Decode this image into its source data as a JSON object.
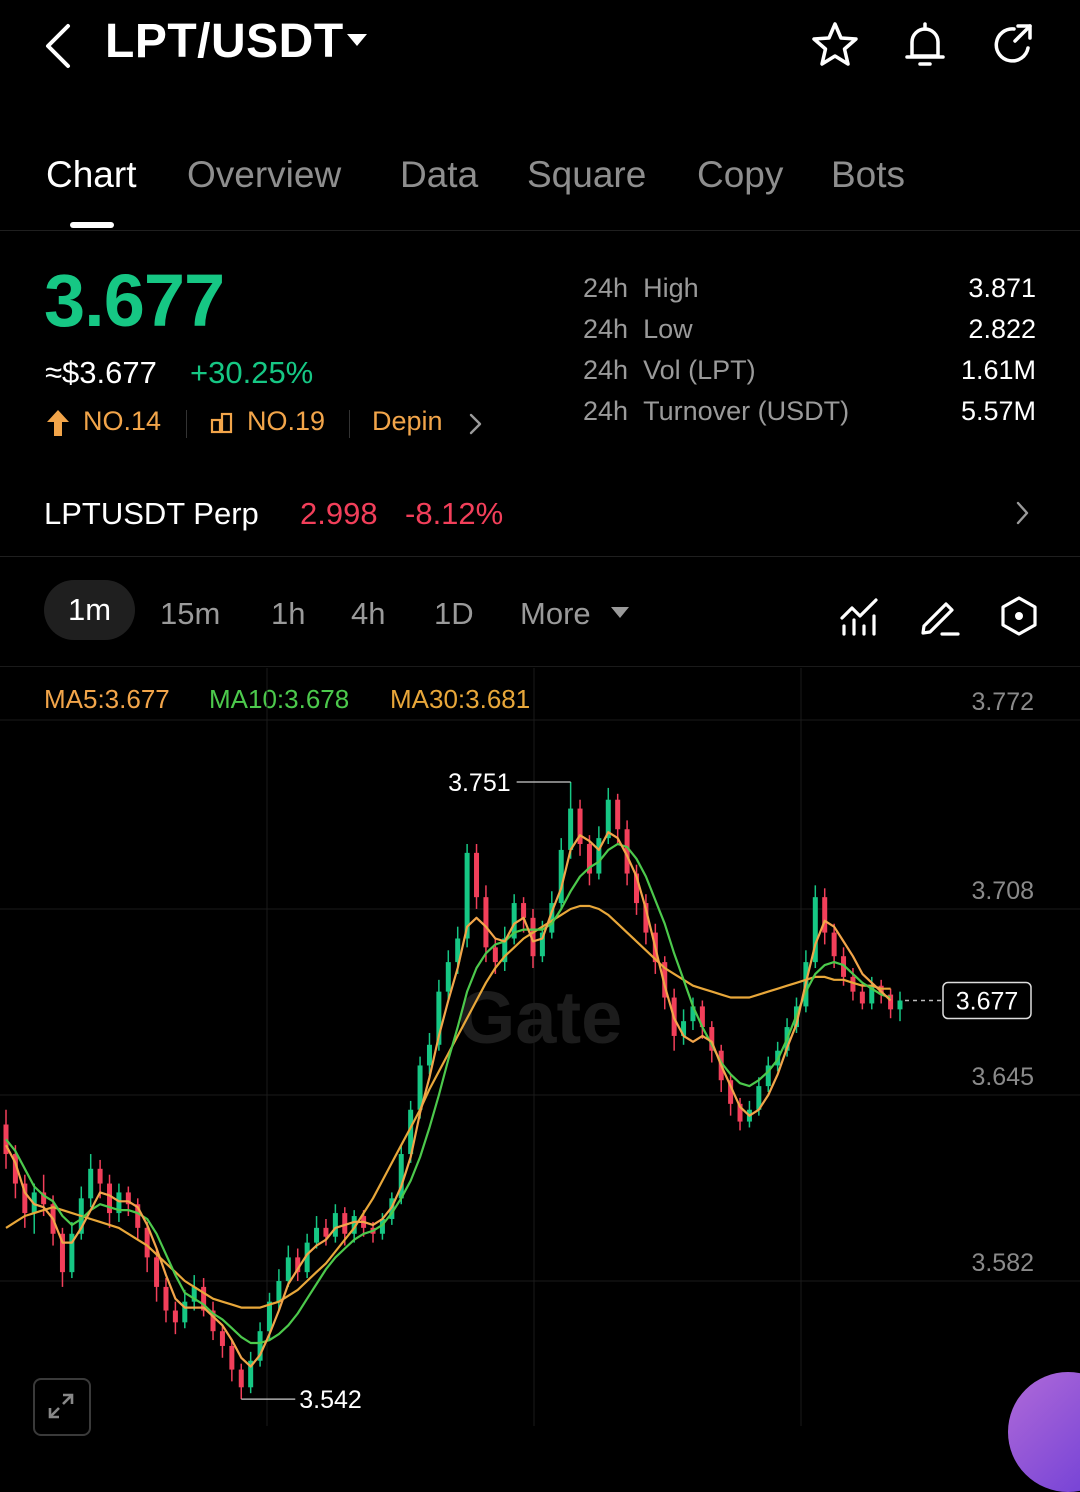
{
  "header": {
    "pair": "LPT/USDT",
    "icons": [
      "back-arrow-icon",
      "dropdown-caret-icon",
      "star-icon",
      "bell-icon",
      "share-icon"
    ]
  },
  "tabs": [
    "Chart",
    "Overview",
    "Data",
    "Square",
    "Copy",
    "Bots"
  ],
  "active_tab": "Chart",
  "ticker": {
    "price": "3.677",
    "usd_price": "≈$3.677",
    "change": "+30.25%",
    "rank1": "NO.14",
    "rank2": "NO.19",
    "tag": "Depin",
    "stats": [
      {
        "period": "24h",
        "label": "High",
        "value": "3.871"
      },
      {
        "period": "24h",
        "label": "Low",
        "value": "2.822"
      },
      {
        "period": "24h",
        "label": "Vol (LPT)",
        "value": "1.61M"
      },
      {
        "period": "24h",
        "label": "Turnover (USDT)",
        "value": "5.57M"
      }
    ]
  },
  "perp": {
    "name": "LPTUSDT Perp",
    "price": "2.998",
    "change": "-8.12%"
  },
  "timeframes": [
    "1m",
    "15m",
    "1h",
    "4h",
    "1D",
    "More"
  ],
  "active_timeframe": "1m",
  "indicators": {
    "ma5": "MA5:3.677",
    "ma10": "MA10:3.678",
    "ma30": "MA30:3.681"
  },
  "colors": {
    "up": "#16c784",
    "down": "#f23f5a",
    "ma5": "#f2a54a",
    "ma10": "#4cc94c",
    "ma30": "#e8a73a"
  },
  "chart_data": {
    "type": "candlestick",
    "y_ticks": [
      "3.772",
      "3.708",
      "3.645",
      "3.582"
    ],
    "ylim": [
      3.535,
      3.79
    ],
    "high_marker": "3.751",
    "low_marker": "3.542",
    "current_price": "3.677",
    "watermark": "Gate",
    "candles": [
      [
        3.635,
        3.625,
        3.64,
        3.62
      ],
      [
        3.625,
        3.615,
        3.628,
        3.61
      ],
      [
        3.615,
        3.605,
        3.618,
        3.6
      ],
      [
        3.605,
        3.612,
        3.615,
        3.598
      ],
      [
        3.612,
        3.608,
        3.618,
        3.604
      ],
      [
        3.608,
        3.598,
        3.611,
        3.594
      ],
      [
        3.598,
        3.585,
        3.6,
        3.58
      ],
      [
        3.585,
        3.598,
        3.602,
        3.583
      ],
      [
        3.598,
        3.61,
        3.614,
        3.596
      ],
      [
        3.61,
        3.62,
        3.625,
        3.607
      ],
      [
        3.62,
        3.615,
        3.623,
        3.61
      ],
      [
        3.615,
        3.605,
        3.618,
        3.6
      ],
      [
        3.605,
        3.612,
        3.615,
        3.602
      ],
      [
        3.612,
        3.608,
        3.614,
        3.604
      ],
      [
        3.608,
        3.6,
        3.61,
        3.596
      ],
      [
        3.6,
        3.59,
        3.602,
        3.585
      ],
      [
        3.59,
        3.58,
        3.593,
        3.575
      ],
      [
        3.58,
        3.572,
        3.583,
        3.568
      ],
      [
        3.572,
        3.568,
        3.575,
        3.564
      ],
      [
        3.568,
        3.575,
        3.579,
        3.566
      ],
      [
        3.575,
        3.58,
        3.584,
        3.572
      ],
      [
        3.58,
        3.572,
        3.583,
        3.57
      ],
      [
        3.572,
        3.565,
        3.575,
        3.562
      ],
      [
        3.565,
        3.56,
        3.567,
        3.556
      ],
      [
        3.56,
        3.552,
        3.562,
        3.548
      ],
      [
        3.552,
        3.546,
        3.554,
        3.542
      ],
      [
        3.546,
        3.555,
        3.558,
        3.544
      ],
      [
        3.555,
        3.565,
        3.568,
        3.553
      ],
      [
        3.565,
        3.575,
        3.578,
        3.562
      ],
      [
        3.575,
        3.582,
        3.586,
        3.572
      ],
      [
        3.582,
        3.59,
        3.594,
        3.58
      ],
      [
        3.59,
        3.585,
        3.593,
        3.582
      ],
      [
        3.585,
        3.595,
        3.598,
        3.583
      ],
      [
        3.595,
        3.6,
        3.604,
        3.593
      ],
      [
        3.6,
        3.597,
        3.603,
        3.594
      ],
      [
        3.597,
        3.605,
        3.608,
        3.595
      ],
      [
        3.605,
        3.598,
        3.607,
        3.594
      ],
      [
        3.598,
        3.604,
        3.606,
        3.595
      ],
      [
        3.604,
        3.6,
        3.606,
        3.597
      ],
      [
        3.6,
        3.598,
        3.602,
        3.595
      ],
      [
        3.598,
        3.603,
        3.605,
        3.596
      ],
      [
        3.603,
        3.61,
        3.612,
        3.601
      ],
      [
        3.61,
        3.625,
        3.628,
        3.608
      ],
      [
        3.625,
        3.64,
        3.643,
        3.622
      ],
      [
        3.64,
        3.655,
        3.658,
        3.637
      ],
      [
        3.655,
        3.662,
        3.666,
        3.652
      ],
      [
        3.662,
        3.68,
        3.684,
        3.66
      ],
      [
        3.68,
        3.69,
        3.694,
        3.677
      ],
      [
        3.69,
        3.698,
        3.702,
        3.686
      ],
      [
        3.698,
        3.727,
        3.73,
        3.695
      ],
      [
        3.727,
        3.712,
        3.73,
        3.708
      ],
      [
        3.712,
        3.695,
        3.716,
        3.69
      ],
      [
        3.695,
        3.69,
        3.698,
        3.686
      ],
      [
        3.69,
        3.698,
        3.702,
        3.687
      ],
      [
        3.698,
        3.71,
        3.713,
        3.696
      ],
      [
        3.71,
        3.705,
        3.712,
        3.7
      ],
      [
        3.705,
        3.692,
        3.708,
        3.688
      ],
      [
        3.692,
        3.7,
        3.704,
        3.69
      ],
      [
        3.7,
        3.71,
        3.714,
        3.698
      ],
      [
        3.71,
        3.728,
        3.732,
        3.708
      ],
      [
        3.728,
        3.742,
        3.751,
        3.725
      ],
      [
        3.742,
        3.73,
        3.745,
        3.726
      ],
      [
        3.73,
        3.72,
        3.733,
        3.716
      ],
      [
        3.72,
        3.732,
        3.736,
        3.718
      ],
      [
        3.732,
        3.745,
        3.749,
        3.73
      ],
      [
        3.745,
        3.735,
        3.747,
        3.73
      ],
      [
        3.735,
        3.72,
        3.738,
        3.716
      ],
      [
        3.72,
        3.71,
        3.723,
        3.706
      ],
      [
        3.71,
        3.7,
        3.713,
        3.696
      ],
      [
        3.7,
        3.69,
        3.703,
        3.686
      ],
      [
        3.69,
        3.678,
        3.692,
        3.674
      ],
      [
        3.678,
        3.665,
        3.681,
        3.66
      ],
      [
        3.665,
        3.67,
        3.674,
        3.662
      ],
      [
        3.67,
        3.675,
        3.678,
        3.667
      ],
      [
        3.675,
        3.668,
        3.677,
        3.664
      ],
      [
        3.668,
        3.66,
        3.67,
        3.656
      ],
      [
        3.66,
        3.65,
        3.662,
        3.646
      ],
      [
        3.65,
        3.642,
        3.652,
        3.638
      ],
      [
        3.642,
        3.636,
        3.644,
        3.633
      ],
      [
        3.636,
        3.64,
        3.643,
        3.634
      ],
      [
        3.64,
        3.648,
        3.651,
        3.638
      ],
      [
        3.648,
        3.655,
        3.658,
        3.646
      ],
      [
        3.655,
        3.66,
        3.663,
        3.653
      ],
      [
        3.66,
        3.668,
        3.671,
        3.658
      ],
      [
        3.668,
        3.675,
        3.678,
        3.666
      ],
      [
        3.675,
        3.69,
        3.694,
        3.673
      ],
      [
        3.69,
        3.712,
        3.716,
        3.688
      ],
      [
        3.712,
        3.7,
        3.715,
        3.696
      ],
      [
        3.7,
        3.692,
        3.703,
        3.688
      ],
      [
        3.692,
        3.685,
        3.695,
        3.682
      ],
      [
        3.685,
        3.68,
        3.688,
        3.677
      ],
      [
        3.68,
        3.676,
        3.683,
        3.674
      ],
      [
        3.676,
        3.682,
        3.685,
        3.674
      ],
      [
        3.682,
        3.679,
        3.684,
        3.676
      ],
      [
        3.679,
        3.674,
        3.681,
        3.671
      ],
      [
        3.674,
        3.677,
        3.68,
        3.67
      ]
    ],
    "ma5": [
      3.628,
      3.622,
      3.612,
      3.608,
      3.607,
      3.603,
      3.595,
      3.595,
      3.6,
      3.606,
      3.612,
      3.611,
      3.609,
      3.609,
      3.607,
      3.601,
      3.593,
      3.584,
      3.576,
      3.573,
      3.573,
      3.573,
      3.57,
      3.567,
      3.562,
      3.556,
      3.553,
      3.557,
      3.564,
      3.572,
      3.581,
      3.586,
      3.591,
      3.594,
      3.596,
      3.6,
      3.601,
      3.602,
      3.602,
      3.601,
      3.603,
      3.607,
      3.614,
      3.624,
      3.639,
      3.651,
      3.665,
      3.677,
      3.688,
      3.702,
      3.705,
      3.702,
      3.698,
      3.697,
      3.703,
      3.705,
      3.697,
      3.698,
      3.707,
      3.715,
      3.728,
      3.733,
      3.731,
      3.728,
      3.734,
      3.732,
      3.726,
      3.719,
      3.708,
      3.695,
      3.682,
      3.671,
      3.665,
      3.663,
      3.665,
      3.663,
      3.655,
      3.648,
      3.641,
      3.638,
      3.64,
      3.645,
      3.652,
      3.661,
      3.669,
      3.683,
      3.696,
      3.704,
      3.702,
      3.697,
      3.692,
      3.686,
      3.683,
      3.68,
      3.677
    ],
    "ma10": [
      3.63,
      3.626,
      3.62,
      3.614,
      3.611,
      3.609,
      3.604,
      3.601,
      3.603,
      3.606,
      3.608,
      3.607,
      3.606,
      3.606,
      3.605,
      3.603,
      3.598,
      3.591,
      3.584,
      3.578,
      3.576,
      3.574,
      3.571,
      3.569,
      3.566,
      3.563,
      3.561,
      3.561,
      3.562,
      3.564,
      3.567,
      3.571,
      3.576,
      3.581,
      3.586,
      3.59,
      3.593,
      3.596,
      3.598,
      3.599,
      3.601,
      3.605,
      3.61,
      3.616,
      3.624,
      3.634,
      3.645,
      3.657,
      3.668,
      3.68,
      3.688,
      3.693,
      3.696,
      3.697,
      3.7,
      3.701,
      3.701,
      3.701,
      3.703,
      3.708,
      3.714,
      3.719,
      3.722,
      3.724,
      3.728,
      3.73,
      3.729,
      3.725,
      3.719,
      3.711,
      3.703,
      3.693,
      3.684,
      3.675,
      3.668,
      3.662,
      3.656,
      3.652,
      3.649,
      3.648,
      3.65,
      3.653,
      3.657,
      3.664,
      3.672,
      3.68,
      3.686,
      3.689,
      3.69,
      3.689,
      3.686,
      3.683,
      3.681,
      3.679,
      3.678
    ],
    "ma30": [
      3.6,
      3.602,
      3.604,
      3.605,
      3.606,
      3.607,
      3.606,
      3.605,
      3.604,
      3.603,
      3.602,
      3.601,
      3.6,
      3.598,
      3.596,
      3.594,
      3.591,
      3.588,
      3.585,
      3.582,
      3.58,
      3.578,
      3.576,
      3.575,
      3.574,
      3.573,
      3.573,
      3.573,
      3.574,
      3.575,
      3.577,
      3.579,
      3.582,
      3.585,
      3.588,
      3.592,
      3.596,
      3.6,
      3.605,
      3.61,
      3.616,
      3.622,
      3.628,
      3.634,
      3.64,
      3.647,
      3.653,
      3.659,
      3.665,
      3.671,
      3.677,
      3.683,
      3.688,
      3.692,
      3.695,
      3.698,
      3.7,
      3.702,
      3.704,
      3.706,
      3.708,
      3.709,
      3.709,
      3.708,
      3.706,
      3.703,
      3.7,
      3.697,
      3.694,
      3.691,
      3.688,
      3.686,
      3.684,
      3.682,
      3.681,
      3.68,
      3.679,
      3.678,
      3.678,
      3.678,
      3.679,
      3.68,
      3.681,
      3.682,
      3.683,
      3.684,
      3.685,
      3.685,
      3.684,
      3.684,
      3.683,
      3.682,
      3.682,
      3.681,
      3.681
    ]
  }
}
